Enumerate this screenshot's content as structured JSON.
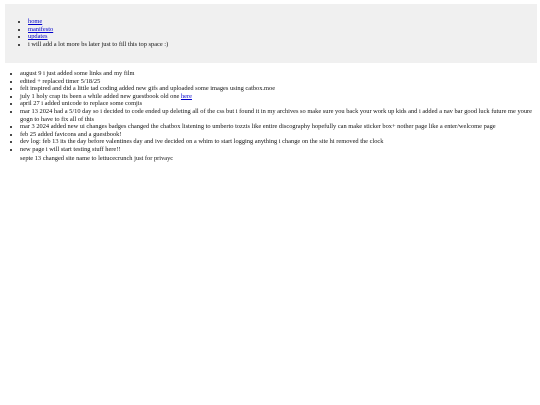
{
  "nav": {
    "home": "home",
    "manifesto": "manifesto",
    "updates": "updates",
    "note": "i will add a lot more bs later just to fill this top space :)"
  },
  "updates": [
    {
      "text": "august 9 i just added some links and my film"
    },
    {
      "text": "edited + replaced timer 5/18/25"
    },
    {
      "text": "felt inspired and did a little tad coding added new gifs and uploaded some images using catbox.moe"
    },
    {
      "text": "july 1 holy crap its been a while added new guestbook old one ",
      "link": "here"
    },
    {
      "text": "april 27 i added unicode to replace some comjis"
    },
    {
      "text": "mar 13 2024 had a 5/10 day so i decided to code ended up deleting all of the css but i found it in my archives so make sure you back your work up kids and i added a nav bar good luck future me youre gogn to have to fix all of this"
    },
    {
      "text": "mar 3 2024 added new ui changes badges changed the chatbox listening to umberto tozzis like entire discography hopefully can make sticker box+ nother page like a enter/welcome page"
    },
    {
      "text": "feb 25 added favicons and a guestbook!"
    },
    {
      "text": "dev log: feb 13 its the day before valentines day and ive decided on a whim to start logging anything i change on the site hi removed the clock"
    },
    {
      "text": "new page i will start testing stuff here!!"
    }
  ],
  "trailing": "septe 13 changed site name to lettucecrunch just for privayc"
}
